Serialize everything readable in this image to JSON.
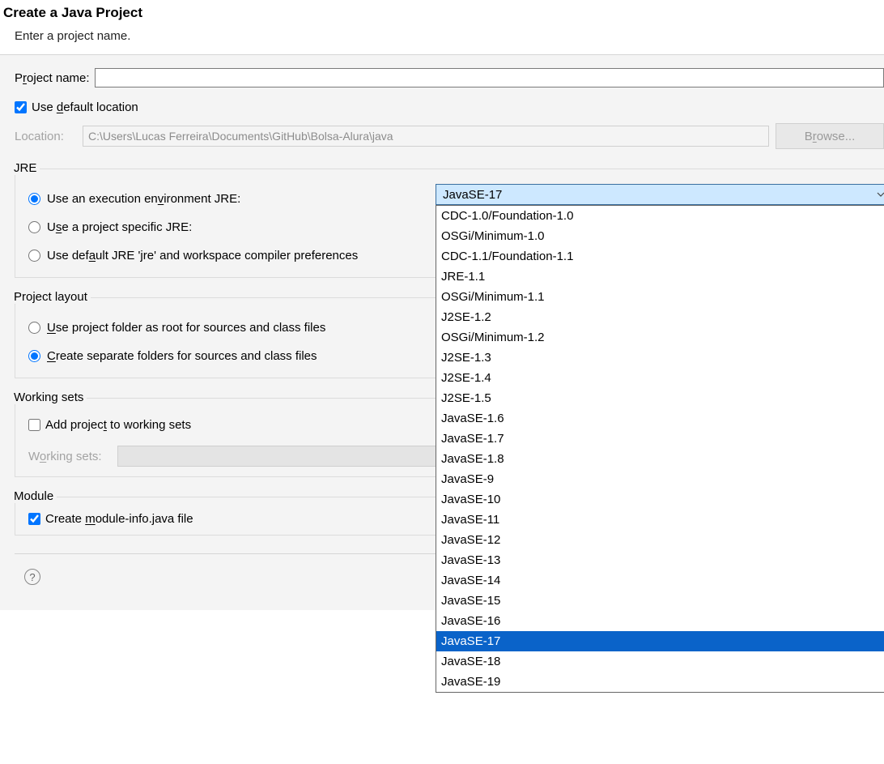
{
  "header": {
    "title": "Create a Java Project",
    "subtitle": "Enter a project name."
  },
  "project_name": {
    "label_pre": "P",
    "label_u": "r",
    "label_post": "oject name:",
    "value": ""
  },
  "default_loc": {
    "pre": "Use ",
    "u": "d",
    "post": "efault location",
    "checked": true
  },
  "location": {
    "label": "Location:",
    "value": "C:\\Users\\Lucas Ferreira\\Documents\\GitHub\\Bolsa-Alura\\java",
    "browse_pre": "B",
    "browse_u": "r",
    "browse_post": "owse..."
  },
  "jre": {
    "legend": "JRE",
    "opt1": {
      "pre": "Use an execution en",
      "u": "v",
      "post": "ironment JRE:"
    },
    "opt2": {
      "pre": "U",
      "u": "s",
      "post": "e a project specific JRE:"
    },
    "opt3": {
      "pre": "Use def",
      "u": "a",
      "post": "ult JRE 'jre' and workspace compiler preferences"
    },
    "combo_selected": "JavaSE-17",
    "options": [
      "CDC-1.0/Foundation-1.0",
      "OSGi/Minimum-1.0",
      "CDC-1.1/Foundation-1.1",
      "JRE-1.1",
      "OSGi/Minimum-1.1",
      "J2SE-1.2",
      "OSGi/Minimum-1.2",
      "J2SE-1.3",
      "J2SE-1.4",
      "J2SE-1.5",
      "JavaSE-1.6",
      "JavaSE-1.7",
      "JavaSE-1.8",
      "JavaSE-9",
      "JavaSE-10",
      "JavaSE-11",
      "JavaSE-12",
      "JavaSE-13",
      "JavaSE-14",
      "JavaSE-15",
      "JavaSE-16",
      "JavaSE-17",
      "JavaSE-18",
      "JavaSE-19"
    ],
    "selected_index": 21
  },
  "layout": {
    "legend": "Project layout",
    "opt1": {
      "u": "U",
      "post": "se project folder as root for sources and class files"
    },
    "opt2": {
      "u": "C",
      "post": "reate separate folders for sources and class files"
    }
  },
  "ws": {
    "legend": "Working sets",
    "check": {
      "pre": "Add projec",
      "u": "t",
      "post": " to working sets"
    },
    "label": {
      "pre": "W",
      "u": "o",
      "post": "rking sets:"
    }
  },
  "module": {
    "legend": "Module",
    "check": {
      "pre": "Create ",
      "u": "m",
      "post": "odule-info.java file",
      "checked": true
    }
  },
  "help_glyph": "?"
}
